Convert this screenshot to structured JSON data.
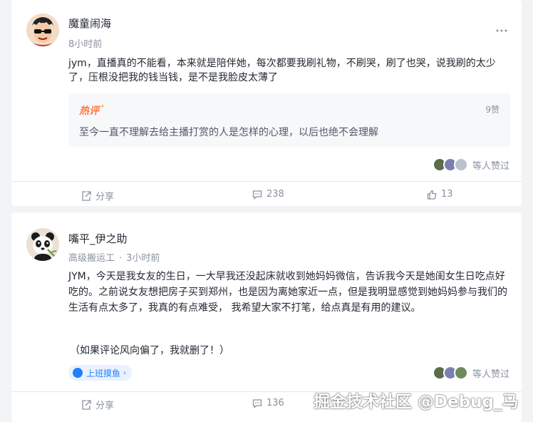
{
  "posts": [
    {
      "author": "魔童闹海",
      "time": "8小时前",
      "content": "jym，直播真的不能看，本来就是陪伴她，每次都要我刷礼物，不刷哭，刷了也哭，说我刷的太少了，压根没把我的钱当钱，是不是我脸皮太薄了",
      "hot_comment": {
        "label": "热评",
        "likes": "9赞",
        "text": "至今一直不理解去给主播打赏的人是怎样的心理，以后也绝不会理解"
      },
      "likers_text": "等人赞过",
      "actions": {
        "share": "分享",
        "comments": "238",
        "likes": "13"
      }
    },
    {
      "author": "嘴平_伊之助",
      "title": "高级搬运工",
      "separator": "·",
      "time": "3小时前",
      "content": "JYM，今天是我女友的生日，一大早我还没起床就收到她妈妈微信，告诉我今天是她闺女生日吃点好吃的。之前说女友想把房子买到郑州，也是因为离她家近一点，但是我明显感觉到她妈妈参与我们的生活有点太多了，我真的有点难受，  我希望大家不打笔，给点真是有用的建议。",
      "extra": "（如果评论风向偏了，我就删了！）",
      "tag": "上班摸鱼",
      "likers_text": "等人赞过",
      "actions": {
        "share": "分享",
        "comments": "136"
      }
    }
  ],
  "watermark": "掘金技术社区 @Debug_马",
  "colors": {
    "page_bg": "#f2f3f5",
    "card_bg": "#ffffff",
    "hot_accent": "#ff7a45",
    "link_blue": "#1e80ff",
    "muted": "#8a919f"
  },
  "icons": [
    "more-icon",
    "share-icon",
    "comment-icon",
    "thumbs-up-icon",
    "tag-icon",
    "chevron-right-icon"
  ]
}
